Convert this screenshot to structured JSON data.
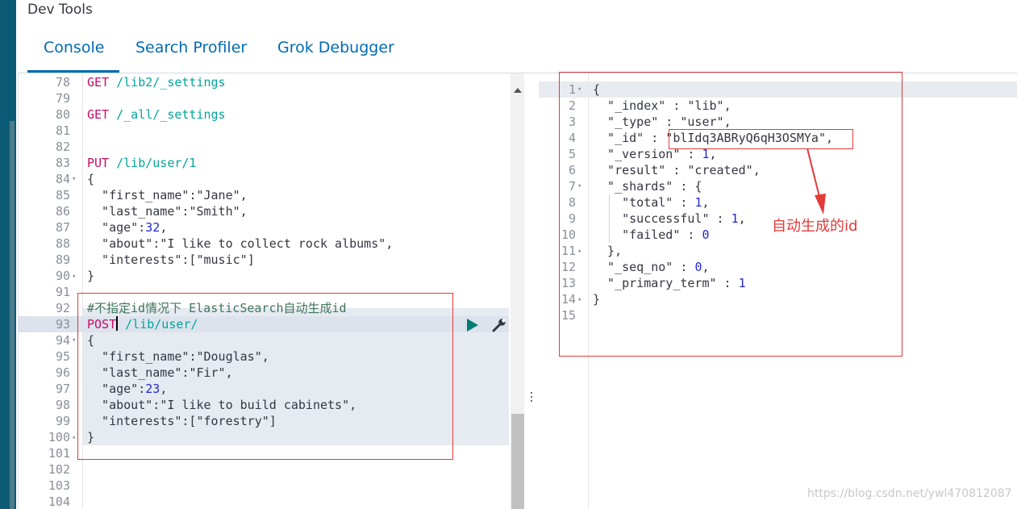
{
  "app": {
    "title": "Dev Tools"
  },
  "tabs": [
    {
      "label": "Console",
      "active": true
    },
    {
      "label": "Search Profiler",
      "active": false
    },
    {
      "label": "Grok Debugger",
      "active": false
    }
  ],
  "editor": {
    "lines": [
      {
        "n": "78",
        "fold": "",
        "parts": [
          [
            "GET",
            "m"
          ],
          [
            " /lib2/_settings",
            "u"
          ]
        ]
      },
      {
        "n": "79",
        "fold": "",
        "parts": []
      },
      {
        "n": "80",
        "fold": "",
        "parts": [
          [
            "GET",
            "m"
          ],
          [
            " /_all/_settings",
            "u"
          ]
        ]
      },
      {
        "n": "81",
        "fold": "",
        "parts": []
      },
      {
        "n": "82",
        "fold": "",
        "parts": []
      },
      {
        "n": "83",
        "fold": "",
        "parts": [
          [
            "PUT",
            "m"
          ],
          [
            " /lib/user/1",
            "u"
          ]
        ]
      },
      {
        "n": "84",
        "fold": "▾",
        "parts": [
          [
            "{",
            "p"
          ]
        ]
      },
      {
        "n": "85",
        "fold": "",
        "parts": [
          [
            "  \"first_name\"",
            "k"
          ],
          [
            ":",
            "p"
          ],
          [
            "\"Jane\"",
            "s"
          ],
          [
            ",",
            "p"
          ]
        ]
      },
      {
        "n": "86",
        "fold": "",
        "parts": [
          [
            "  \"last_name\"",
            "k"
          ],
          [
            ":",
            "p"
          ],
          [
            "\"Smith\"",
            "s"
          ],
          [
            ",",
            "p"
          ]
        ]
      },
      {
        "n": "87",
        "fold": "",
        "parts": [
          [
            "  \"age\"",
            "k"
          ],
          [
            ":",
            "p"
          ],
          [
            "32",
            "n"
          ],
          [
            ",",
            "p"
          ]
        ]
      },
      {
        "n": "88",
        "fold": "",
        "parts": [
          [
            "  \"about\"",
            "k"
          ],
          [
            ":",
            "p"
          ],
          [
            "\"I like to collect rock albums\"",
            "s"
          ],
          [
            ",",
            "p"
          ]
        ]
      },
      {
        "n": "89",
        "fold": "",
        "parts": [
          [
            "  \"interests\"",
            "k"
          ],
          [
            ":[",
            "p"
          ],
          [
            "\"music\"",
            "s"
          ],
          [
            "]",
            "p"
          ]
        ]
      },
      {
        "n": "90",
        "fold": "▴",
        "parts": [
          [
            "}",
            "p"
          ]
        ]
      },
      {
        "n": "91",
        "fold": "",
        "parts": []
      },
      {
        "n": "92",
        "fold": "",
        "parts": [
          [
            "#不指定id情况下 ElasticSearch自动生成id",
            "c"
          ]
        ]
      },
      {
        "n": "93",
        "fold": "",
        "parts": [
          [
            "POST",
            "m"
          ],
          [
            "|",
            "caret"
          ],
          [
            " /lib/user/",
            "u"
          ]
        ]
      },
      {
        "n": "94",
        "fold": "▾",
        "parts": [
          [
            "{",
            "p"
          ]
        ]
      },
      {
        "n": "95",
        "fold": "",
        "parts": [
          [
            "  \"first_name\"",
            "k"
          ],
          [
            ":",
            "p"
          ],
          [
            "\"Douglas\"",
            "s"
          ],
          [
            ",",
            "p"
          ]
        ]
      },
      {
        "n": "96",
        "fold": "",
        "parts": [
          [
            "  \"last_name\"",
            "k"
          ],
          [
            ":",
            "p"
          ],
          [
            "\"Fir\"",
            "s"
          ],
          [
            ",",
            "p"
          ]
        ]
      },
      {
        "n": "97",
        "fold": "",
        "parts": [
          [
            "  \"age\"",
            "k"
          ],
          [
            ":",
            "p"
          ],
          [
            "23",
            "n"
          ],
          [
            ",",
            "p"
          ]
        ]
      },
      {
        "n": "98",
        "fold": "",
        "parts": [
          [
            "  \"about\"",
            "k"
          ],
          [
            ":",
            "p"
          ],
          [
            "\"I like to build cabinets\"",
            "s"
          ],
          [
            ",",
            "p"
          ]
        ]
      },
      {
        "n": "99",
        "fold": "",
        "parts": [
          [
            "  \"interests\"",
            "k"
          ],
          [
            ":[",
            "p"
          ],
          [
            "\"forestry\"",
            "s"
          ],
          [
            "]",
            "p"
          ]
        ]
      },
      {
        "n": "100",
        "fold": "▴",
        "parts": [
          [
            "}",
            "p"
          ]
        ]
      },
      {
        "n": "101",
        "fold": "",
        "parts": []
      },
      {
        "n": "102",
        "fold": "",
        "parts": []
      },
      {
        "n": "103",
        "fold": "",
        "parts": []
      },
      {
        "n": "104",
        "fold": "",
        "parts": []
      }
    ]
  },
  "output": {
    "lines": [
      {
        "n": "1",
        "fold": "▾",
        "parts": [
          [
            "{",
            "p"
          ]
        ]
      },
      {
        "n": "2",
        "fold": "",
        "parts": [
          [
            "  \"_index\"",
            "k"
          ],
          [
            " : ",
            "p"
          ],
          [
            "\"lib\"",
            "s"
          ],
          [
            ",",
            "p"
          ]
        ]
      },
      {
        "n": "3",
        "fold": "",
        "parts": [
          [
            "  \"_type\"",
            "k"
          ],
          [
            " : ",
            "p"
          ],
          [
            "\"user\"",
            "s"
          ],
          [
            ",",
            "p"
          ]
        ]
      },
      {
        "n": "4",
        "fold": "",
        "parts": [
          [
            "  \"_id\"",
            "k"
          ],
          [
            " : ",
            "p"
          ],
          [
            "\"blIdq3ABRyQ6qH3OSMYa\"",
            "s"
          ],
          [
            ",",
            "p"
          ]
        ]
      },
      {
        "n": "5",
        "fold": "",
        "parts": [
          [
            "  \"_version\"",
            "k"
          ],
          [
            " : ",
            "p"
          ],
          [
            "1",
            "n"
          ],
          [
            ",",
            "p"
          ]
        ]
      },
      {
        "n": "6",
        "fold": "",
        "parts": [
          [
            "  \"result\"",
            "k"
          ],
          [
            " : ",
            "p"
          ],
          [
            "\"created\"",
            "s"
          ],
          [
            ",",
            "p"
          ]
        ]
      },
      {
        "n": "7",
        "fold": "▾",
        "parts": [
          [
            "  \"_shards\"",
            "k"
          ],
          [
            " : {",
            "p"
          ]
        ]
      },
      {
        "n": "8",
        "fold": "",
        "parts": [
          [
            "    \"total\"",
            "k"
          ],
          [
            " : ",
            "p"
          ],
          [
            "1",
            "n"
          ],
          [
            ",",
            "p"
          ]
        ]
      },
      {
        "n": "9",
        "fold": "",
        "parts": [
          [
            "    \"successful\"",
            "k"
          ],
          [
            " : ",
            "p"
          ],
          [
            "1",
            "n"
          ],
          [
            ",",
            "p"
          ]
        ]
      },
      {
        "n": "10",
        "fold": "",
        "parts": [
          [
            "    \"failed\"",
            "k"
          ],
          [
            " : ",
            "p"
          ],
          [
            "0",
            "n"
          ]
        ]
      },
      {
        "n": "11",
        "fold": "▴",
        "parts": [
          [
            "  },",
            "p"
          ]
        ]
      },
      {
        "n": "12",
        "fold": "",
        "parts": [
          [
            "  \"_seq_no\"",
            "k"
          ],
          [
            " : ",
            "p"
          ],
          [
            "0",
            "n"
          ],
          [
            ",",
            "p"
          ]
        ]
      },
      {
        "n": "13",
        "fold": "",
        "parts": [
          [
            "  \"_primary_term\"",
            "k"
          ],
          [
            " : ",
            "p"
          ],
          [
            "1",
            "n"
          ]
        ]
      },
      {
        "n": "14",
        "fold": "▴",
        "parts": [
          [
            "}",
            "p"
          ]
        ]
      },
      {
        "n": "15",
        "fold": "",
        "parts": []
      }
    ]
  },
  "annotation": {
    "label": "自动生成的id",
    "color": "#e33a3a"
  },
  "watermark": "https://blog.csdn.net/ywl470812087",
  "icons": {
    "run": "play-icon",
    "settings": "wrench-icon"
  }
}
